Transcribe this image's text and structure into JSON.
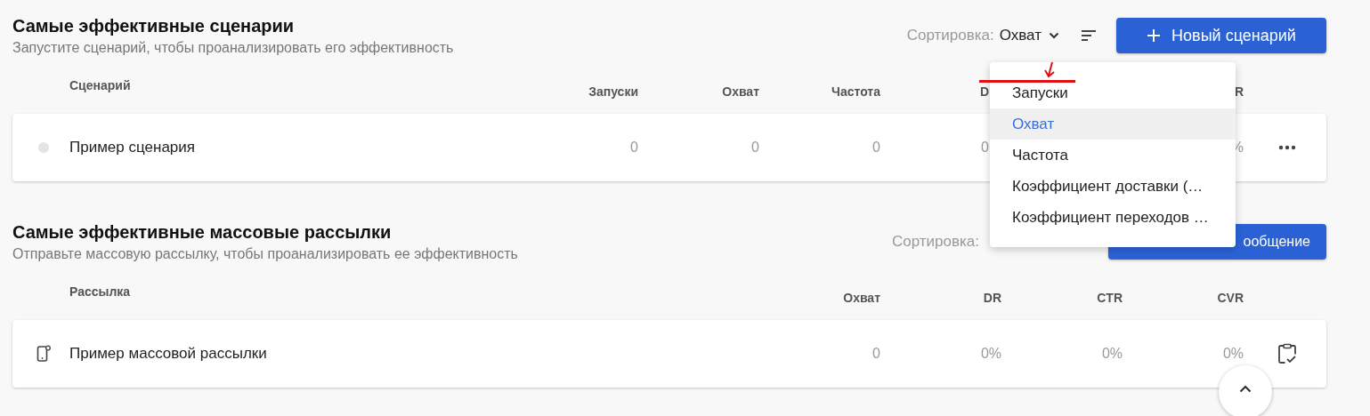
{
  "sections": [
    {
      "title": "Самые эффективные сценарии",
      "subtitle": "Запустите сценарий, чтобы проанализировать его эффективность",
      "sort": {
        "label": "Сортировка:",
        "value": "Охват"
      },
      "button": {
        "label": "Новый сценарий",
        "kind": "full"
      },
      "name_column": "Сценарий",
      "columns": [
        {
          "label": "Запуски",
          "kind": "full"
        },
        {
          "label": "Охват",
          "kind": "full"
        },
        {
          "label": "Частота",
          "kind": "full"
        },
        {
          "label": "D",
          "kind": "cut"
        },
        {
          "kind": "covered"
        },
        {
          "label": "R",
          "kind": "full"
        }
      ],
      "rows": [
        {
          "name": "Пример сценария",
          "kind": "scenario",
          "cells": [
            "0",
            "0",
            "0",
            "0",
            "%"
          ]
        }
      ]
    },
    {
      "title": "Самые эффективные массовые рассылки",
      "subtitle": "Отправьте массовую рассылку, чтобы проанализировать ее эффективность",
      "sort": {
        "label": "Сортировка:"
      },
      "button": {
        "label": "ообщение",
        "kind": "cut"
      },
      "name_column": "Рассылка",
      "columns": [
        {
          "label": "Охват",
          "kind": "full"
        },
        {
          "label": "DR",
          "kind": "full"
        },
        {
          "label": "CTR",
          "kind": "full"
        },
        {
          "label": "CVR",
          "kind": "full"
        }
      ],
      "rows": [
        {
          "name": "Пример массовой рассылки",
          "kind": "broadcast",
          "cells": [
            "0",
            "0%",
            "0%",
            "0%"
          ]
        }
      ]
    }
  ],
  "sort_menu": {
    "items": [
      {
        "label": "Запуски",
        "selected": false
      },
      {
        "label": "Охват",
        "selected": true
      },
      {
        "label": "Частота",
        "selected": false
      },
      {
        "label": "Коэффициент доставки (…",
        "selected": false
      },
      {
        "label": "Коэффициент переходов …",
        "selected": false
      }
    ]
  }
}
